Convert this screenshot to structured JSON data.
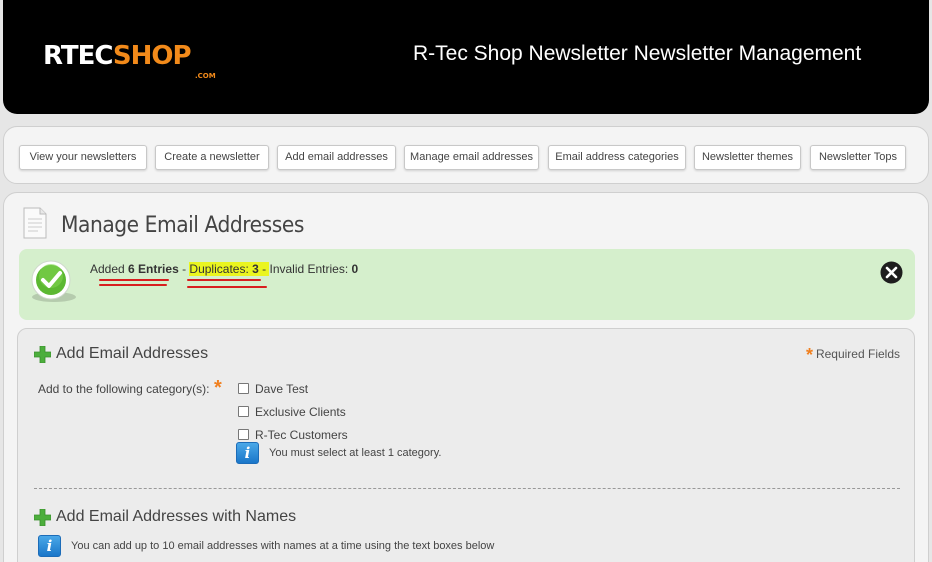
{
  "header": {
    "logo_part1": "RTEC",
    "logo_part2": "SHOP",
    "logo_suffix": ".COM",
    "title": "R-Tec Shop Newsletter Newsletter Management"
  },
  "nav": [
    {
      "label": "View your newsletters"
    },
    {
      "label": "Create a newsletter"
    },
    {
      "label": "Add email addresses"
    },
    {
      "label": "Manage email addresses"
    },
    {
      "label": "Email address categories"
    },
    {
      "label": "Newsletter themes"
    },
    {
      "label": "Newsletter Tops"
    }
  ],
  "page": {
    "title": "Manage Email Addresses"
  },
  "message": {
    "added_prefix": "Added ",
    "added_count": "6 Entries",
    "sep1": " - ",
    "duplicates_label": "Duplicates: ",
    "duplicates_count": "3",
    "sep2": " - ",
    "invalid_label": "Invalid Entries: ",
    "invalid_count": "0"
  },
  "form": {
    "section1_title": "Add Email Addresses",
    "required_label": "Required Fields",
    "category_label": "Add to the following category(s):",
    "categories": [
      {
        "label": "Dave Test",
        "checked": false
      },
      {
        "label": "Exclusive Clients",
        "checked": false
      },
      {
        "label": "R-Tec Customers",
        "checked": false
      }
    ],
    "category_hint": "You must select at least 1 category.",
    "section2_title": "Add Email Addresses with Names",
    "section2_hint": "You can add up to 10 email addresses with names at a time using the text boxes below"
  },
  "colors": {
    "header_bg": "#000000",
    "brand_orange": "#f28a1a",
    "success_bg": "#d5efcc",
    "highlight": "#eaf51f",
    "annotation_red": "#d81e1e",
    "info_blue": "#1a76c9",
    "plus_green": "#4cae3c"
  }
}
